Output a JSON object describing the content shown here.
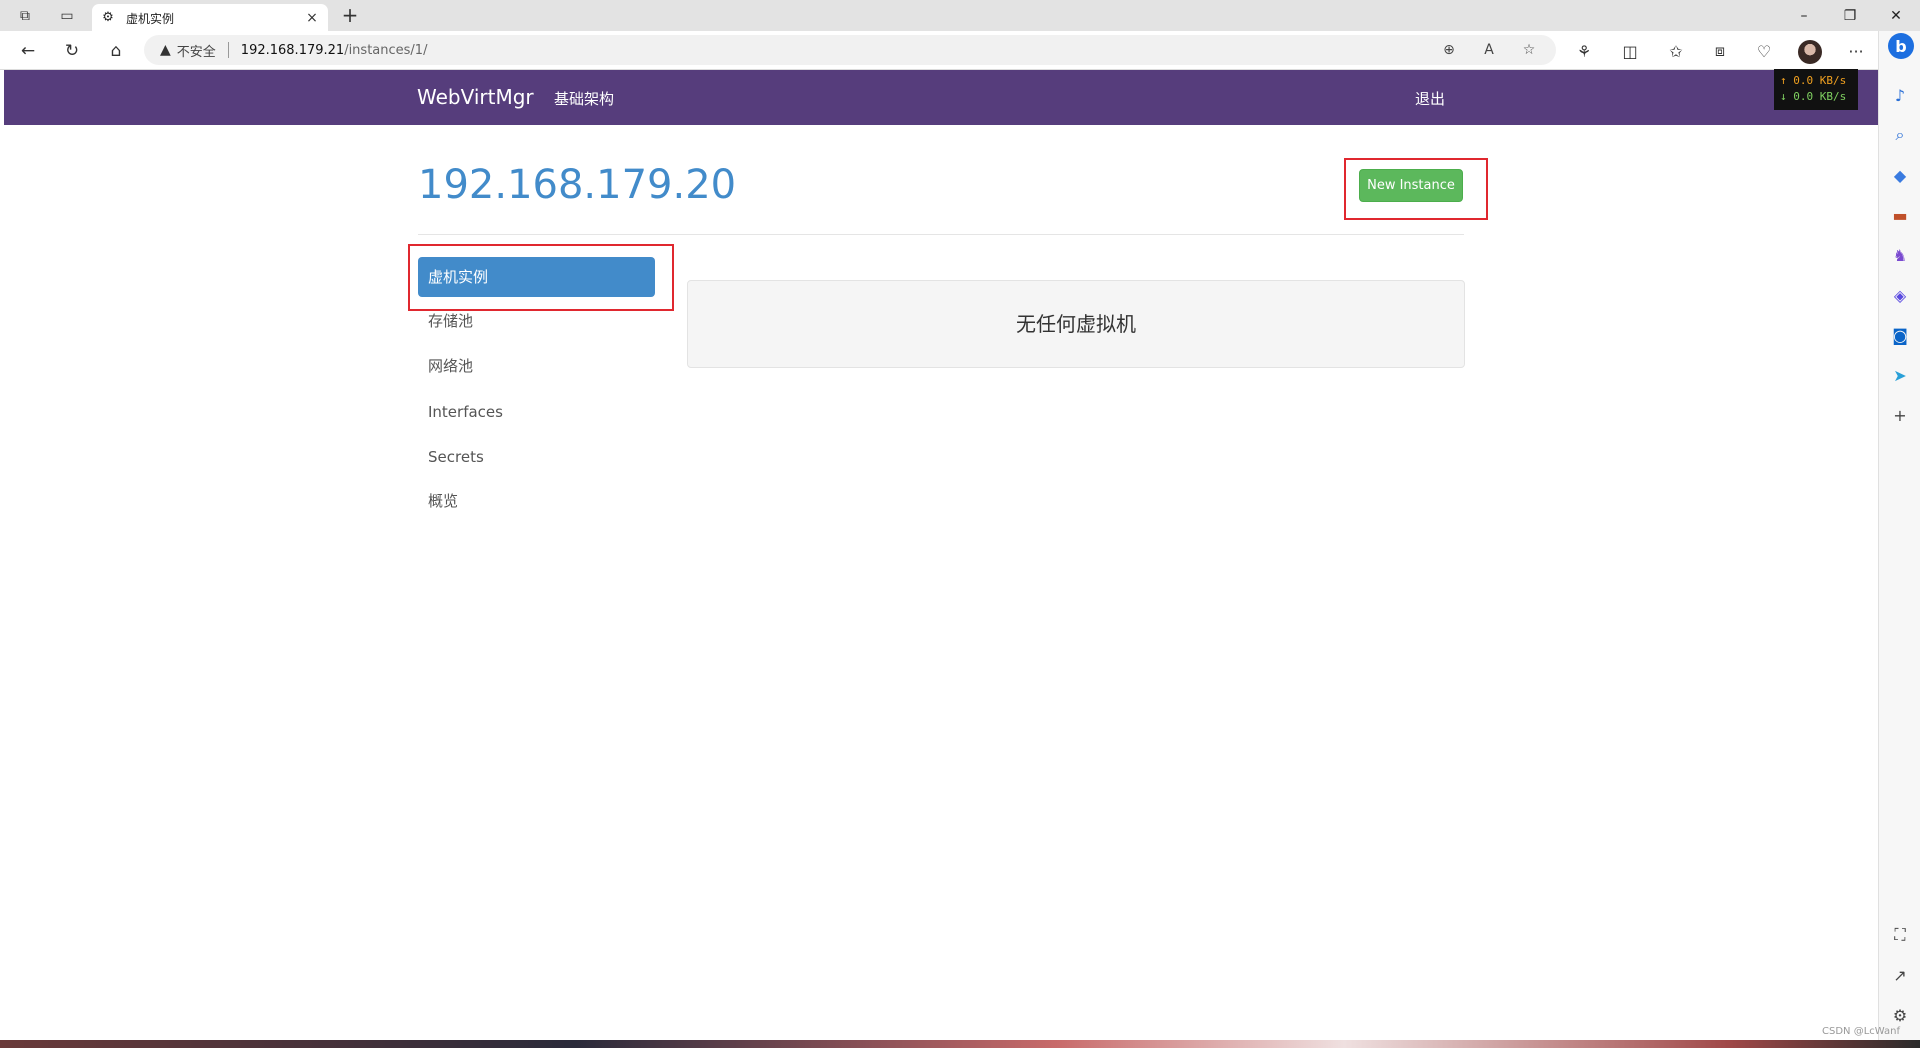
{
  "browser": {
    "tab_title": "虚机实例",
    "new_tab_symbol": "+",
    "tab_close_symbol": "×",
    "address": {
      "security_label": "不安全",
      "host": "192.168.179.21",
      "path": "/instances/1/"
    },
    "window_controls": {
      "minimize": "–",
      "restore": "❐",
      "close": "✕"
    },
    "more_menu": "···"
  },
  "netspeed": {
    "up": "↑ 0.0 KB/s",
    "down": "↓ 0.0 KB/s"
  },
  "site": {
    "brand": "WebVirtMgr",
    "nav_infrastructure": "基础架构",
    "nav_logout": "退出",
    "navbar_color": "#563d7c"
  },
  "page": {
    "host_title": "192.168.179.20",
    "new_instance_button": "New Instance",
    "empty_message": "无任何虚拟机"
  },
  "sidebar": {
    "items": [
      {
        "label": "虚机实例",
        "active": true
      },
      {
        "label": "存储池",
        "active": false
      },
      {
        "label": "网络池",
        "active": false
      },
      {
        "label": "Interfaces",
        "active": false
      },
      {
        "label": "Secrets",
        "active": false
      },
      {
        "label": "概览",
        "active": false
      }
    ]
  },
  "watermark": "CSDN @LcWanf",
  "colors": {
    "accent": "#428bca",
    "success": "#5cb85c",
    "highlight": "#e0282f"
  }
}
